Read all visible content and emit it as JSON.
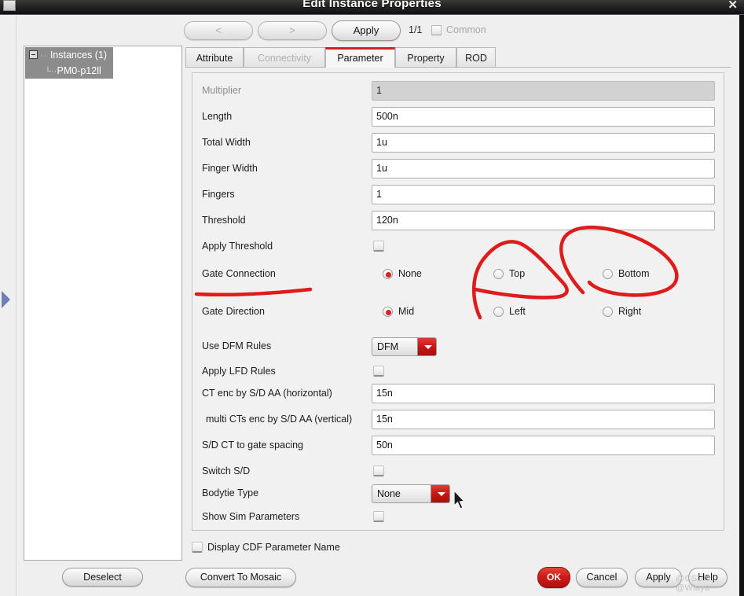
{
  "window": {
    "title": "Edit Instance Properties",
    "close_icon": "close-icon",
    "app_icon": "window-icon"
  },
  "toolbar": {
    "prev_label": "<",
    "next_label": ">",
    "apply_label": "Apply",
    "page_count": "1/1",
    "common_label": "Common",
    "common_checked": false
  },
  "tabs": [
    {
      "label": "Attribute",
      "state": "normal"
    },
    {
      "label": "Connectivity",
      "state": "disabled"
    },
    {
      "label": "Parameter",
      "state": "active"
    },
    {
      "label": "Property",
      "state": "normal"
    },
    {
      "label": "ROD",
      "state": "normal"
    }
  ],
  "tree": {
    "root_label": "Instances (1)",
    "child_label": "PM0-p12ll",
    "expander_icon": "collapse-icon",
    "deselect_label": "Deselect"
  },
  "edge": {
    "handle_icon": "expand-arrow-icon"
  },
  "form": {
    "rows": [
      {
        "label": "Multiplier",
        "type": "text",
        "value": "1",
        "readonly": true
      },
      {
        "label": "Length",
        "type": "text",
        "value": "500n"
      },
      {
        "label": "Total Width",
        "type": "text",
        "value": "1u"
      },
      {
        "label": "Finger Width",
        "type": "text",
        "value": "1u"
      },
      {
        "label": "Fingers",
        "type": "text",
        "value": "1"
      },
      {
        "label": "Threshold",
        "type": "text",
        "value": "120n"
      },
      {
        "label": "Apply Threshold",
        "type": "checkbox",
        "checked": false
      },
      {
        "label": "Gate Connection",
        "type": "radio",
        "options": [
          "None",
          "Top",
          "Bottom"
        ],
        "selected": "None"
      },
      {
        "label": "Gate Direction",
        "type": "radio",
        "options": [
          "Mid",
          "Left",
          "Right"
        ],
        "selected": "Mid"
      },
      {
        "label": "Use DFM Rules",
        "type": "select",
        "value": "DFM"
      },
      {
        "label": "Apply LFD Rules",
        "type": "checkbox",
        "checked": false
      },
      {
        "label": "CT enc by S/D AA (horizontal)",
        "type": "text",
        "value": "15n"
      },
      {
        "label": "multi CTs enc by S/D AA (vertical)",
        "type": "text",
        "value": "15n",
        "indent": true
      },
      {
        "label": "S/D CT to gate spacing",
        "type": "text",
        "value": "50n"
      },
      {
        "label": "Switch S/D",
        "type": "checkbox",
        "checked": false
      },
      {
        "label": "Bodytie Type",
        "type": "select",
        "value": "None"
      },
      {
        "label": "Show Sim Parameters",
        "type": "checkbox",
        "checked": false
      }
    ]
  },
  "footer": {
    "cdf_label": "Display CDF Parameter Name",
    "cdf_checked": false,
    "convert_label": "Convert To Mosaic",
    "ok_label": "OK",
    "cancel_label": "Cancel",
    "apply_label": "Apply",
    "help_label": "Help"
  },
  "watermark": {
    "text": "@CSDN @Wiaya"
  },
  "colors": {
    "accent_red": "#d4232a",
    "ok_red": "#cf1b18",
    "annotation_red": "#e01b1b",
    "tab_active_underline": "#d21f1f",
    "window_bg": "#efefef",
    "titlebar": "#1a1a1a"
  },
  "annotations": {
    "type": "freehand-ink",
    "color": "#e01b1b",
    "marks": [
      {
        "name": "circle-top-radio",
        "target": "Top"
      },
      {
        "name": "circle-bottom-radio",
        "target": "Bottom"
      },
      {
        "name": "underline-gate-connection",
        "target": "Gate Connection"
      }
    ]
  }
}
